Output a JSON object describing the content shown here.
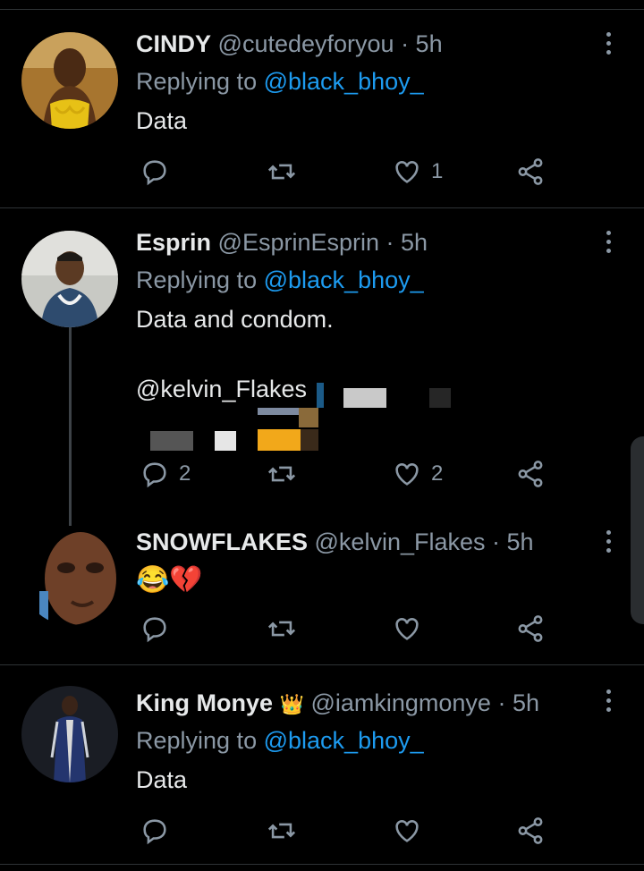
{
  "tweets": [
    {
      "name": "CINDY",
      "handle": "@cutedeyforyou",
      "time": "· 5h",
      "replying_prefix": "Replying to",
      "replying_to": "@black_bhoy_",
      "text": "Data",
      "reply_count": "",
      "retweet_count": "",
      "like_count": "1"
    },
    {
      "name": "Esprin",
      "handle": "@EsprinEsprin",
      "time": "· 5h",
      "replying_prefix": "Replying to",
      "replying_to": "@black_bhoy_",
      "text": "Data and condom.",
      "mention_line": "@kelvin_Flakes",
      "reply_count": "2",
      "retweet_count": "",
      "like_count": "2"
    },
    {
      "name": "SNOWFLAKES",
      "handle": "@kelvin_Flakes",
      "time": "· 5h",
      "text": "😂💔",
      "reply_count": "",
      "retweet_count": "",
      "like_count": ""
    },
    {
      "name": "King Monye",
      "badge": "👑",
      "handle": "@iamkingmonye",
      "time": "· 5h",
      "replying_prefix": "Replying to",
      "replying_to": "@black_bhoy_",
      "text": "Data",
      "reply_count": "",
      "retweet_count": "",
      "like_count": ""
    }
  ],
  "icons": {
    "reply": "reply-icon",
    "retweet": "retweet-icon",
    "like": "heart-icon",
    "share": "share-icon",
    "more": "more-vertical-icon"
  },
  "colors": {
    "background": "#000000",
    "text": "#e7e9ea",
    "secondary": "#8b98a5",
    "link": "#1d9bf0"
  }
}
